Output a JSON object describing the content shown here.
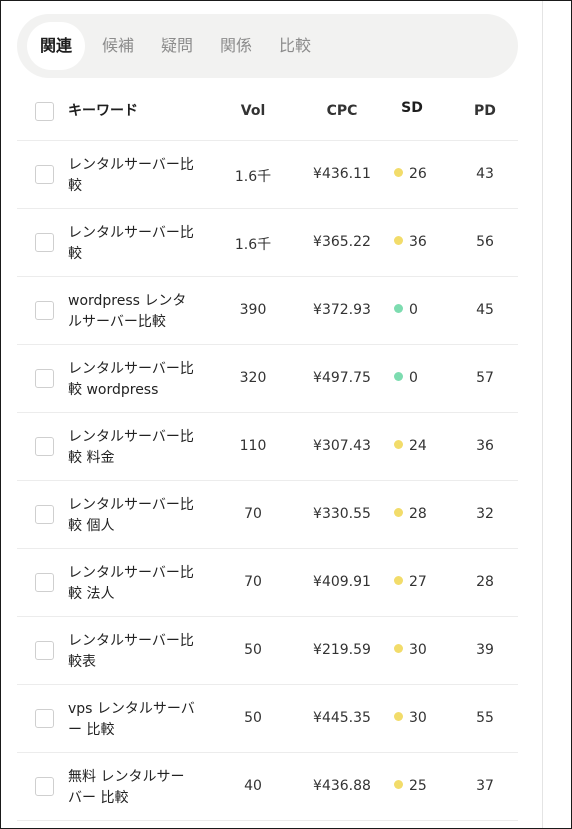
{
  "tabs": [
    {
      "label": "関連",
      "active": true
    },
    {
      "label": "候補",
      "active": false
    },
    {
      "label": "疑問",
      "active": false
    },
    {
      "label": "関係",
      "active": false
    },
    {
      "label": "比較",
      "active": false
    }
  ],
  "table": {
    "columns": {
      "keyword": "キーワード",
      "vol": "Vol",
      "cpc": "CPC",
      "sd": "SD",
      "pd": "PD"
    },
    "rows": [
      {
        "keyword": "レンタルサーバー比較",
        "vol": "1.6千",
        "cpc": "¥436.11",
        "sd": "26",
        "pd": "43"
      },
      {
        "keyword": "レンタルサーバー比較",
        "vol": "1.6千",
        "cpc": "¥365.22",
        "sd": "36",
        "pd": "56"
      },
      {
        "keyword": "wordpress レンタルサーバー比較",
        "vol": "390",
        "cpc": "¥372.93",
        "sd": "0",
        "pd": "45"
      },
      {
        "keyword": "レンタルサーバー比較 wordpress",
        "vol": "320",
        "cpc": "¥497.75",
        "sd": "0",
        "pd": "57"
      },
      {
        "keyword": "レンタルサーバー比較 料金",
        "vol": "110",
        "cpc": "¥307.43",
        "sd": "24",
        "pd": "36"
      },
      {
        "keyword": "レンタルサーバー比較 個人",
        "vol": "70",
        "cpc": "¥330.55",
        "sd": "28",
        "pd": "32"
      },
      {
        "keyword": "レンタルサーバー比較 法人",
        "vol": "70",
        "cpc": "¥409.91",
        "sd": "27",
        "pd": "28"
      },
      {
        "keyword": "レンタルサーバー比較表",
        "vol": "50",
        "cpc": "¥219.59",
        "sd": "30",
        "pd": "39"
      },
      {
        "keyword": "vps レンタルサーバー 比較",
        "vol": "50",
        "cpc": "¥445.35",
        "sd": "30",
        "pd": "55"
      },
      {
        "keyword": "無料 レンタルサーバー 比較",
        "vol": "40",
        "cpc": "¥436.88",
        "sd": "25",
        "pd": "37"
      }
    ]
  },
  "colors": {
    "sd_easy": "#7ddcb0",
    "sd_medium": "#f2dc6a",
    "tab_bar_bg": "#f2f2f1"
  }
}
